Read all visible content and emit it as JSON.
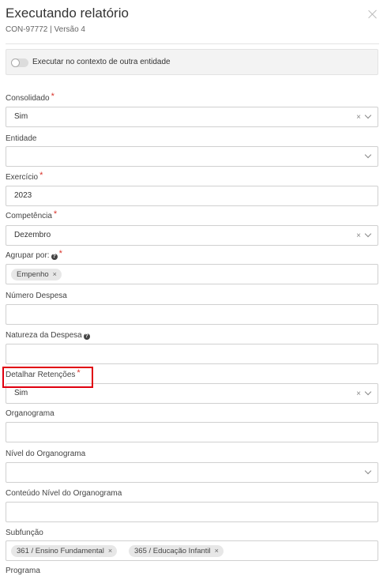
{
  "header": {
    "title": "Executando relatório",
    "subtitle": "CON-97772 | Versão 4"
  },
  "context_toggle": {
    "label": "Executar no contexto de outra entidade",
    "on": false
  },
  "fields": {
    "consolidado": {
      "label": "Consolidado",
      "required": true,
      "value": "Sim"
    },
    "entidade": {
      "label": "Entidade",
      "value": ""
    },
    "exercicio": {
      "label": "Exercício",
      "required": true,
      "value": "2023"
    },
    "competencia": {
      "label": "Competência",
      "required": true,
      "value": "Dezembro"
    },
    "agrupar": {
      "label": "Agrupar por:",
      "required": true,
      "help": true,
      "tags": [
        "Empenho"
      ]
    },
    "numero_despesa": {
      "label": "Número Despesa",
      "value": ""
    },
    "natureza": {
      "label": "Natureza da Despesa",
      "help": true,
      "value": ""
    },
    "detalhar": {
      "label": "Detalhar Retenções",
      "required": true,
      "value": "Sim"
    },
    "organograma": {
      "label": "Organograma",
      "value": ""
    },
    "nivel_organograma": {
      "label": "Nível do Organograma",
      "value": ""
    },
    "conteudo_nivel": {
      "label": "Conteúdo Nível do Organograma",
      "value": ""
    },
    "subfuncao": {
      "label": "Subfunção",
      "tags": [
        "361 / Ensino Fundamental",
        "365 / Educação Infantil"
      ]
    },
    "programa": {
      "label": "Programa"
    }
  },
  "symbols": {
    "required_mark": "*",
    "help_mark": "?",
    "clear_mark": "×"
  }
}
